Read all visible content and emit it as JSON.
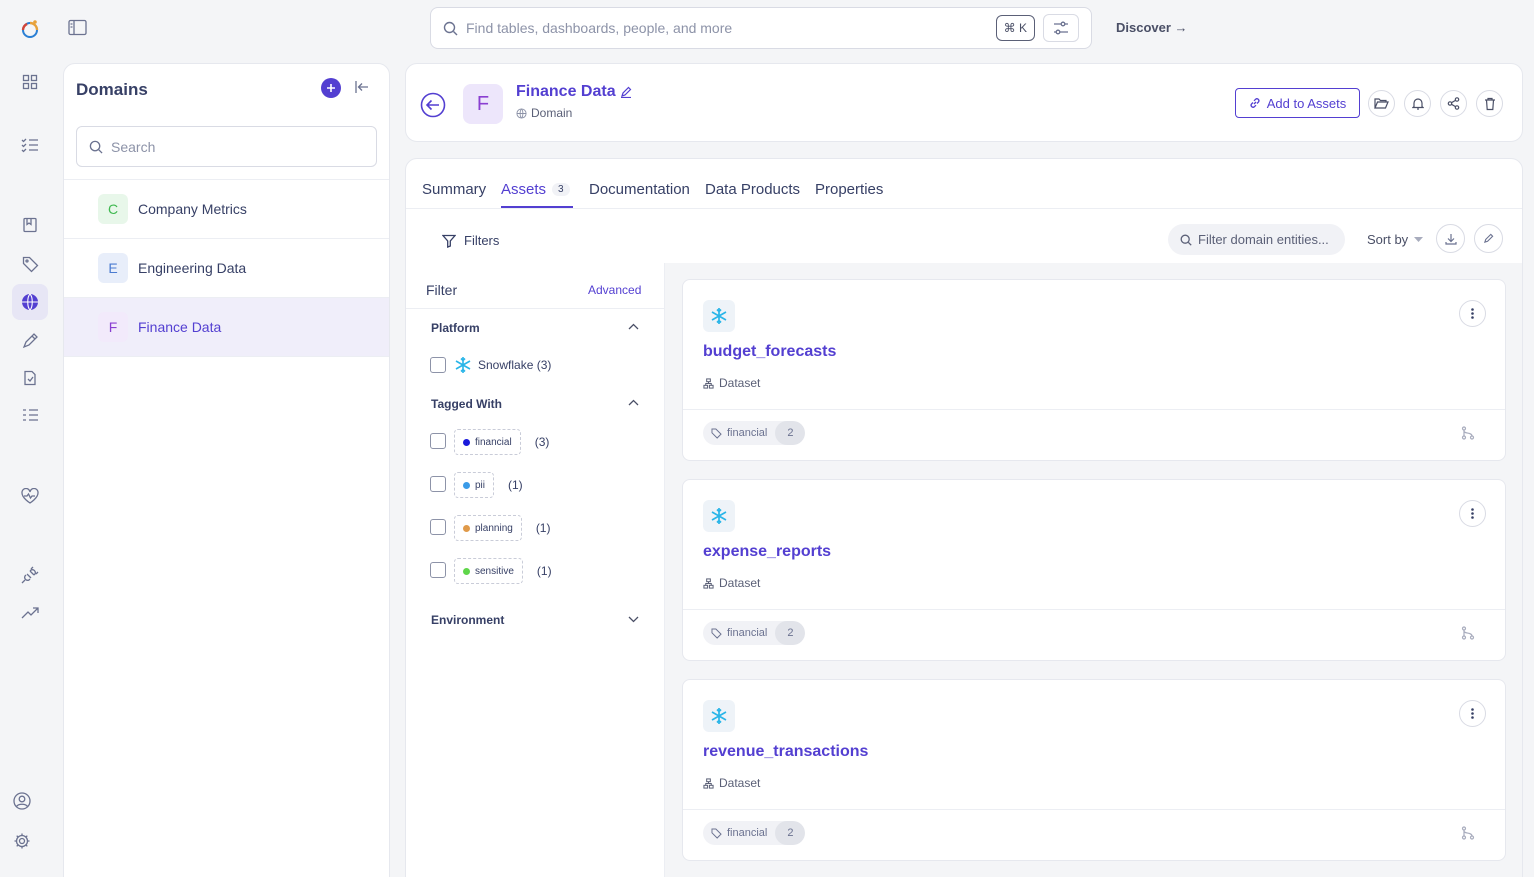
{
  "app": {
    "search_placeholder": "Find tables, dashboards, people, and more",
    "search_shortcut": "⌘ K",
    "discover_label": "Discover →"
  },
  "domains_panel": {
    "title": "Domains",
    "search_placeholder": "Search",
    "items": [
      {
        "initial": "C",
        "name": "Company Metrics",
        "color": "#3fb950",
        "bg": "#e8f7ea"
      },
      {
        "initial": "E",
        "name": "Engineering Data",
        "color": "#4a7bd0",
        "bg": "#e8eefa"
      },
      {
        "initial": "F",
        "name": "Finance Data",
        "color": "#8a3fd1",
        "bg": "#f2eafb"
      }
    ]
  },
  "entity": {
    "initial": "F",
    "name": "Finance Data",
    "type": "Domain",
    "add_to_assets": "Add to Assets"
  },
  "tabs": [
    {
      "label": "Summary"
    },
    {
      "label": "Assets",
      "count": "3"
    },
    {
      "label": "Documentation"
    },
    {
      "label": "Data Products"
    },
    {
      "label": "Properties"
    }
  ],
  "toolbar": {
    "filters_label": "Filters",
    "filter_entities_placeholder": "Filter domain entities...",
    "sort_label": "Sort by"
  },
  "filter_panel": {
    "title": "Filter",
    "advanced": "Advanced",
    "platform_section": "Platform",
    "platform_option": "Snowflake (3)",
    "tagged_section": "Tagged With",
    "tags": [
      {
        "label": "financial",
        "count": "(3)",
        "color": "#1a1adb"
      },
      {
        "label": "pii",
        "count": "(1)",
        "color": "#3a9be8"
      },
      {
        "label": "planning",
        "count": "(1)",
        "color": "#e09a4a"
      },
      {
        "label": "sensitive",
        "count": "(1)",
        "color": "#5fd64a"
      }
    ],
    "environment_section": "Environment"
  },
  "assets": [
    {
      "name": "budget_forecasts",
      "type": "Dataset",
      "tag": "financial",
      "tag_count": "2"
    },
    {
      "name": "expense_reports",
      "type": "Dataset",
      "tag": "financial",
      "tag_count": "2"
    },
    {
      "name": "revenue_transactions",
      "type": "Dataset",
      "tag": "financial",
      "tag_count": "2"
    }
  ],
  "colors": {
    "accent": "#533fd1",
    "snowflake": "#29b5e8"
  }
}
